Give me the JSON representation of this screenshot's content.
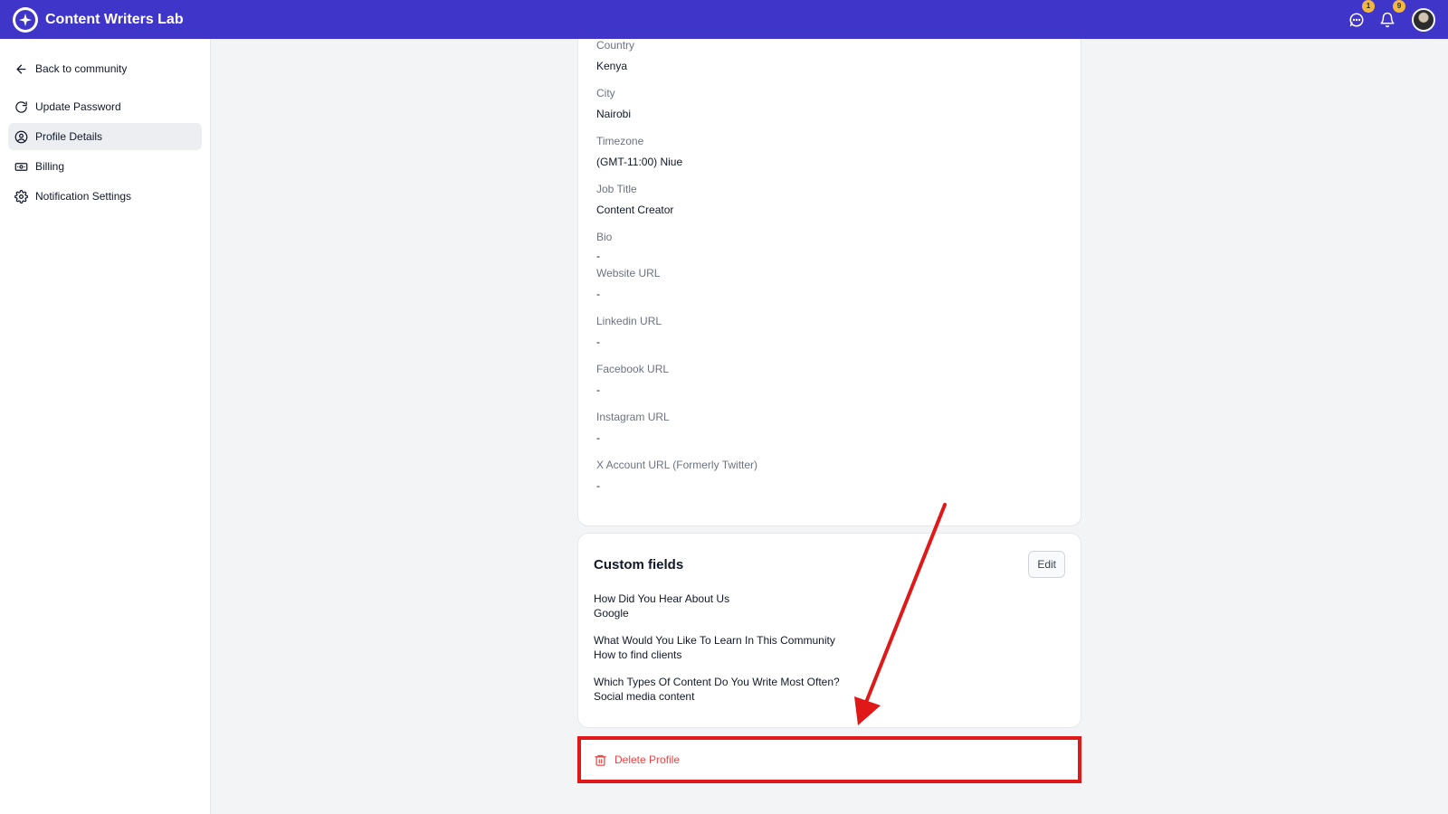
{
  "app": {
    "name": "Content Writers Lab"
  },
  "topbar": {
    "messages_badge": "1",
    "notifications_badge": "9"
  },
  "sidebar": {
    "back_label": "Back to community",
    "items": [
      {
        "label": "Update Password",
        "icon": "refresh-icon"
      },
      {
        "label": "Profile Details",
        "icon": "user-circle-icon",
        "active": true
      },
      {
        "label": "Billing",
        "icon": "money-icon"
      },
      {
        "label": "Notification Settings",
        "icon": "gear-icon"
      }
    ]
  },
  "profile": {
    "fields": [
      {
        "label": "Country",
        "value": "Kenya"
      },
      {
        "label": "City",
        "value": "Nairobi"
      },
      {
        "label": "Timezone",
        "value": "(GMT-11:00) Niue"
      },
      {
        "label": "Job Title",
        "value": "Content Creator"
      },
      {
        "label": "Bio",
        "value": "-"
      },
      {
        "label": "Website URL",
        "value": "-"
      },
      {
        "label": "Linkedin URL",
        "value": "-"
      },
      {
        "label": "Facebook URL",
        "value": "-"
      },
      {
        "label": "Instagram URL",
        "value": "-"
      },
      {
        "label": "X Account URL (Formerly Twitter)",
        "value": "-"
      }
    ]
  },
  "custom_fields": {
    "title": "Custom fields",
    "edit_label": "Edit",
    "items": [
      {
        "question": "How Did You Hear About Us",
        "answer": "Google"
      },
      {
        "question": "What Would You Like To Learn In This Community",
        "answer": "How to find clients"
      },
      {
        "question": "Which Types Of Content Do You Write Most Often?",
        "answer": "Social media content"
      }
    ]
  },
  "delete": {
    "label": "Delete Profile"
  },
  "colors": {
    "brand": "#3f35c8",
    "badge": "#f4b73d",
    "danger": "#ef4444",
    "annotation": "#e01818"
  }
}
